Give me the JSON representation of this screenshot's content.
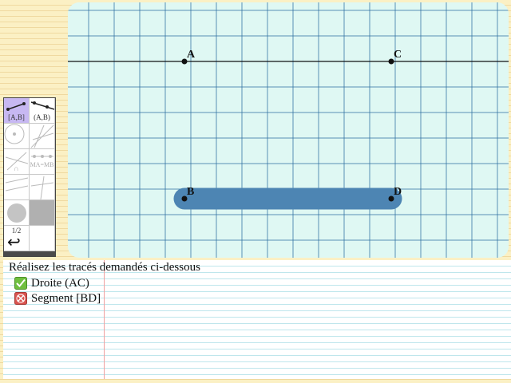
{
  "toolbar": {
    "tools": [
      {
        "id": "segment",
        "label": "[A,B]",
        "selected": true
      },
      {
        "id": "ray",
        "label": "(A,B)",
        "selected": false
      },
      {
        "id": "circle",
        "label": "",
        "selected": false
      },
      {
        "id": "lines",
        "label": "",
        "selected": false
      },
      {
        "id": "intersection",
        "label": "∩",
        "selected": false
      },
      {
        "id": "equidistant",
        "label": "MA=MB",
        "selected": false
      },
      {
        "id": "parallel",
        "label": "",
        "selected": false
      },
      {
        "id": "perpendicular",
        "label": "",
        "selected": false
      },
      {
        "id": "fill-color",
        "label": "",
        "selected": false
      },
      {
        "id": "gray-swatch",
        "label": "",
        "selected": false
      },
      {
        "id": "zoom",
        "label": "1/2",
        "selected": false
      },
      {
        "id": "blank",
        "label": "",
        "selected": false
      }
    ],
    "undo_glyph": "↩"
  },
  "canvas": {
    "points": [
      {
        "name": "A",
        "label": "A"
      },
      {
        "name": "B",
        "label": "B"
      },
      {
        "name": "C",
        "label": "C"
      },
      {
        "name": "D",
        "label": "D"
      }
    ],
    "line_through": [
      "A",
      "C"
    ],
    "highlighted_segment": [
      "B",
      "D"
    ],
    "colors": {
      "grid_bg": "#dff8f3",
      "grid_line": "#2c6fa0",
      "construction": "#111111",
      "highlight": "#4d85b3"
    }
  },
  "instructions": {
    "title": "Réalisez les tracés demandés ci-dessous",
    "tasks": [
      {
        "label": "Droite (AC)",
        "status": "done",
        "icon": "check-icon"
      },
      {
        "label": "Segment [BD]",
        "status": "pending",
        "icon": "cross-icon"
      }
    ],
    "colors": {
      "done": "#6fbf3f",
      "pending": "#d9534f"
    }
  }
}
